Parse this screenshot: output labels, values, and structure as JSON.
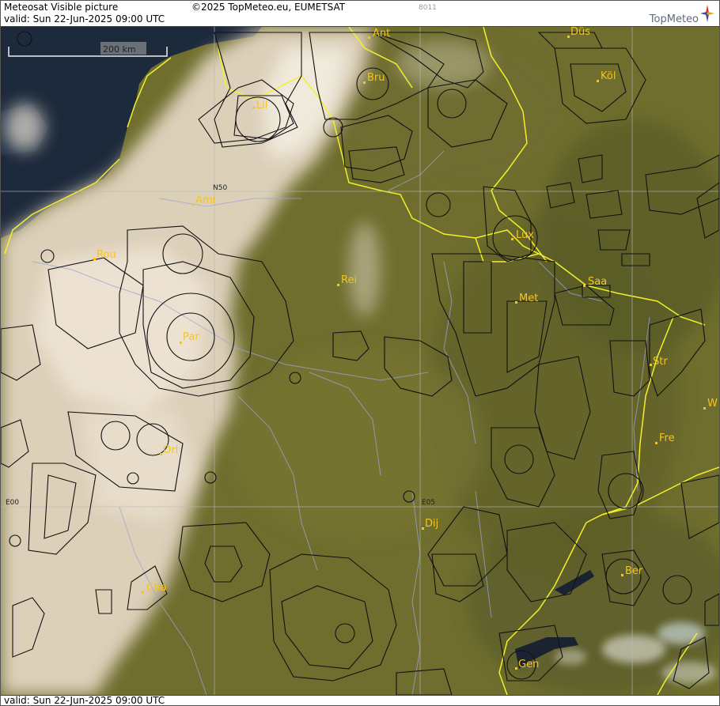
{
  "header": {
    "title": "Meteosat Visible picture",
    "valid": "valid:  Sun  22-Jun-2025  09:00 UTC",
    "copyright": "©2025 TopMeteo.eu, EUMETSAT",
    "code": "8011",
    "brand": "TopMeteo"
  },
  "footer": {
    "valid": "valid:  Sun  22-Jun-2025  09:00 UTC"
  },
  "scale": {
    "label": "200 km"
  },
  "grid_labels": {
    "lat_n50": "N50",
    "lon_e00": "E00",
    "lon_e05": "E05"
  },
  "cities": [
    {
      "name": "Ant"
    },
    {
      "name": "Düs"
    },
    {
      "name": "Bru"
    },
    {
      "name": "Köl"
    },
    {
      "name": "Lil"
    },
    {
      "name": "Ami"
    },
    {
      "name": "Rou"
    },
    {
      "name": "Lux"
    },
    {
      "name": "Rei"
    },
    {
      "name": "Saa"
    },
    {
      "name": "Met"
    },
    {
      "name": "Par"
    },
    {
      "name": "Str"
    },
    {
      "name": "W"
    },
    {
      "name": "Fre"
    },
    {
      "name": "Orl"
    },
    {
      "name": "Dij"
    },
    {
      "name": "Ber"
    },
    {
      "name": "Cha"
    },
    {
      "name": "Gen"
    }
  ],
  "colors": {
    "land": "#6f6e2e",
    "sea": "#1d2a3c",
    "cloud": "#e7dccb",
    "border": "#f3f02a",
    "city": "#f5c518",
    "airspace": "#111111",
    "river": "#9aa6d6"
  }
}
